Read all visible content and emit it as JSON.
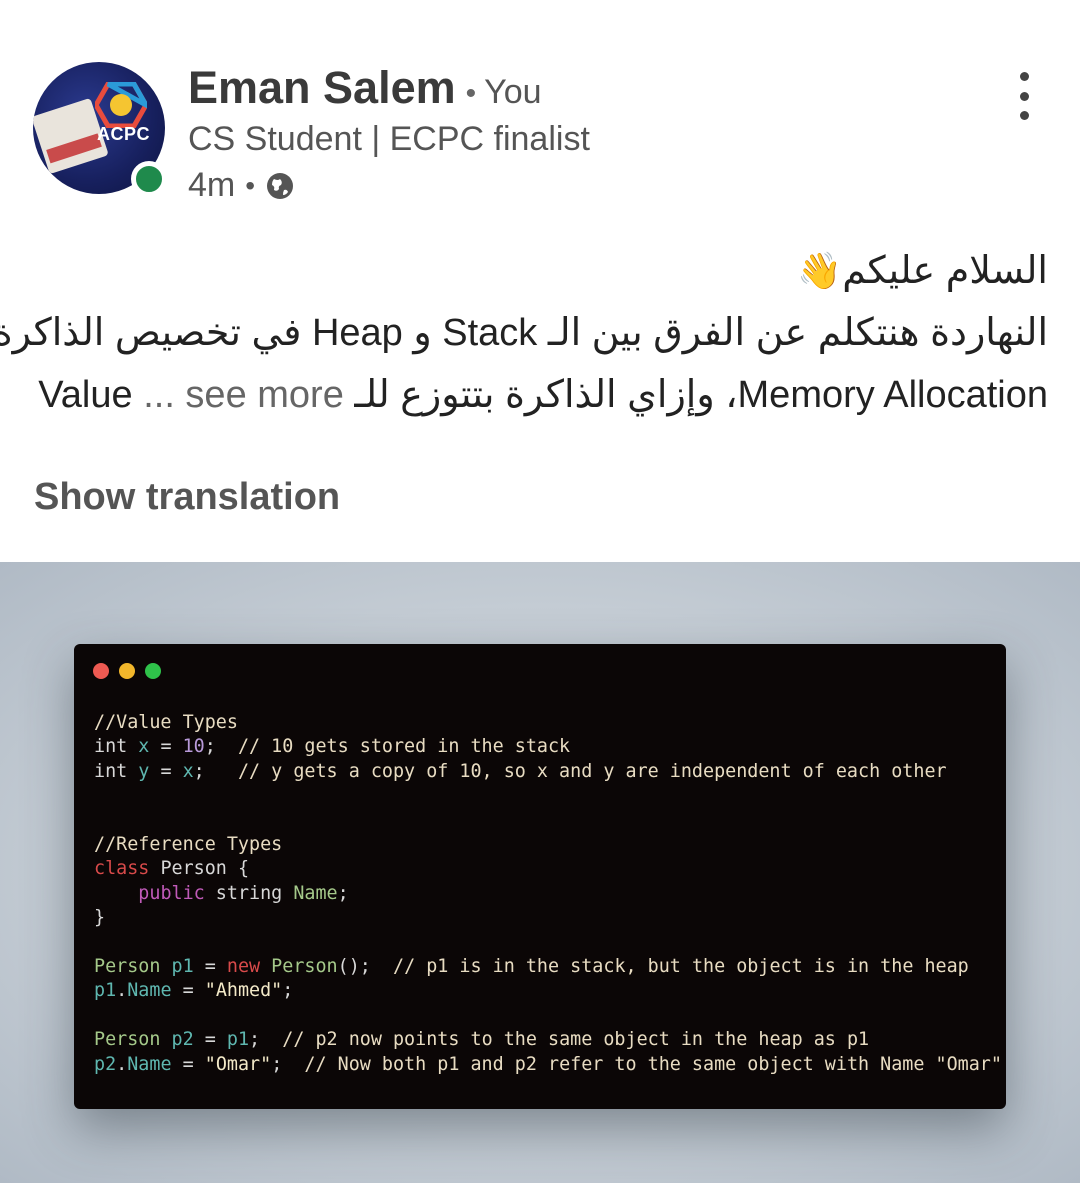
{
  "author": {
    "name": "Eman Salem",
    "you_label": "You",
    "separator": "•",
    "headline": "CS Student | ECPC finalist",
    "time": "4m",
    "visibility_icon": "globe-icon",
    "online_status_color": "#1f8a4c",
    "avatar_logo_text": "ACPC"
  },
  "menu": {
    "icon": "more-vertical-icon"
  },
  "post": {
    "line1": "السلام عليكم",
    "line1_emoji": "👋",
    "line2": "النهاردة هنتكلم عن الفرق بين الـ Stack و Heap في تخصيص الذاكرة",
    "line3": "Memory Allocation، وإزاي الذاكرة بتتوزع للـ Value",
    "see_more": "... see more"
  },
  "show_translation": "Show translation",
  "code_window": {
    "traffic_lights": [
      "#ee5a52",
      "#f2b62b",
      "#2fc24a"
    ],
    "lines": [
      [
        {
          "t": "//Value Types",
          "c": "c-com"
        }
      ],
      [
        {
          "t": "int ",
          "c": "c-type"
        },
        {
          "t": "x",
          "c": "c-var"
        },
        {
          "t": " = ",
          "c": "c-type"
        },
        {
          "t": "10",
          "c": "c-num"
        },
        {
          "t": ";  ",
          "c": "c-type"
        },
        {
          "t": "// 10 gets stored in the stack",
          "c": "c-com"
        }
      ],
      [
        {
          "t": "int ",
          "c": "c-type"
        },
        {
          "t": "y",
          "c": "c-var"
        },
        {
          "t": " = ",
          "c": "c-type"
        },
        {
          "t": "x",
          "c": "c-var"
        },
        {
          "t": ";   ",
          "c": "c-type"
        },
        {
          "t": "// y gets a copy of 10, so x and y are independent of each other",
          "c": "c-com"
        }
      ],
      [],
      [],
      [
        {
          "t": "//Reference Types",
          "c": "c-com"
        }
      ],
      [
        {
          "t": "class",
          "c": "c-kw"
        },
        {
          "t": " Person {",
          "c": "c-type"
        }
      ],
      [
        {
          "t": "    ",
          "c": "c-type"
        },
        {
          "t": "public",
          "c": "c-pub"
        },
        {
          "t": " string ",
          "c": "c-type"
        },
        {
          "t": "Name",
          "c": "c-class"
        },
        {
          "t": ";",
          "c": "c-type"
        }
      ],
      [
        {
          "t": "}",
          "c": "c-type"
        }
      ],
      [],
      [
        {
          "t": "Person ",
          "c": "c-class"
        },
        {
          "t": "p1",
          "c": "c-var"
        },
        {
          "t": " = ",
          "c": "c-type"
        },
        {
          "t": "new",
          "c": "c-kw"
        },
        {
          "t": " Person",
          "c": "c-class"
        },
        {
          "t": "();  ",
          "c": "c-type"
        },
        {
          "t": "// p1 is in the stack, but the object is in the heap",
          "c": "c-com"
        }
      ],
      [
        {
          "t": "p1",
          "c": "c-var"
        },
        {
          "t": ".",
          "c": "c-type"
        },
        {
          "t": "Name",
          "c": "c-var"
        },
        {
          "t": " = ",
          "c": "c-type"
        },
        {
          "t": "\"Ahmed\"",
          "c": "c-str"
        },
        {
          "t": ";",
          "c": "c-type"
        }
      ],
      [],
      [
        {
          "t": "Person ",
          "c": "c-class"
        },
        {
          "t": "p2",
          "c": "c-var"
        },
        {
          "t": " = ",
          "c": "c-type"
        },
        {
          "t": "p1",
          "c": "c-var"
        },
        {
          "t": ";  ",
          "c": "c-type"
        },
        {
          "t": "// p2 now points to the same object in the heap as p1",
          "c": "c-com"
        }
      ],
      [
        {
          "t": "p2",
          "c": "c-var"
        },
        {
          "t": ".",
          "c": "c-type"
        },
        {
          "t": "Name",
          "c": "c-var"
        },
        {
          "t": " = ",
          "c": "c-type"
        },
        {
          "t": "\"Omar\"",
          "c": "c-str"
        },
        {
          "t": ";  ",
          "c": "c-type"
        },
        {
          "t": "// Now both p1 and p2 refer to the same object with Name \"Omar\"",
          "c": "c-com"
        }
      ]
    ]
  }
}
